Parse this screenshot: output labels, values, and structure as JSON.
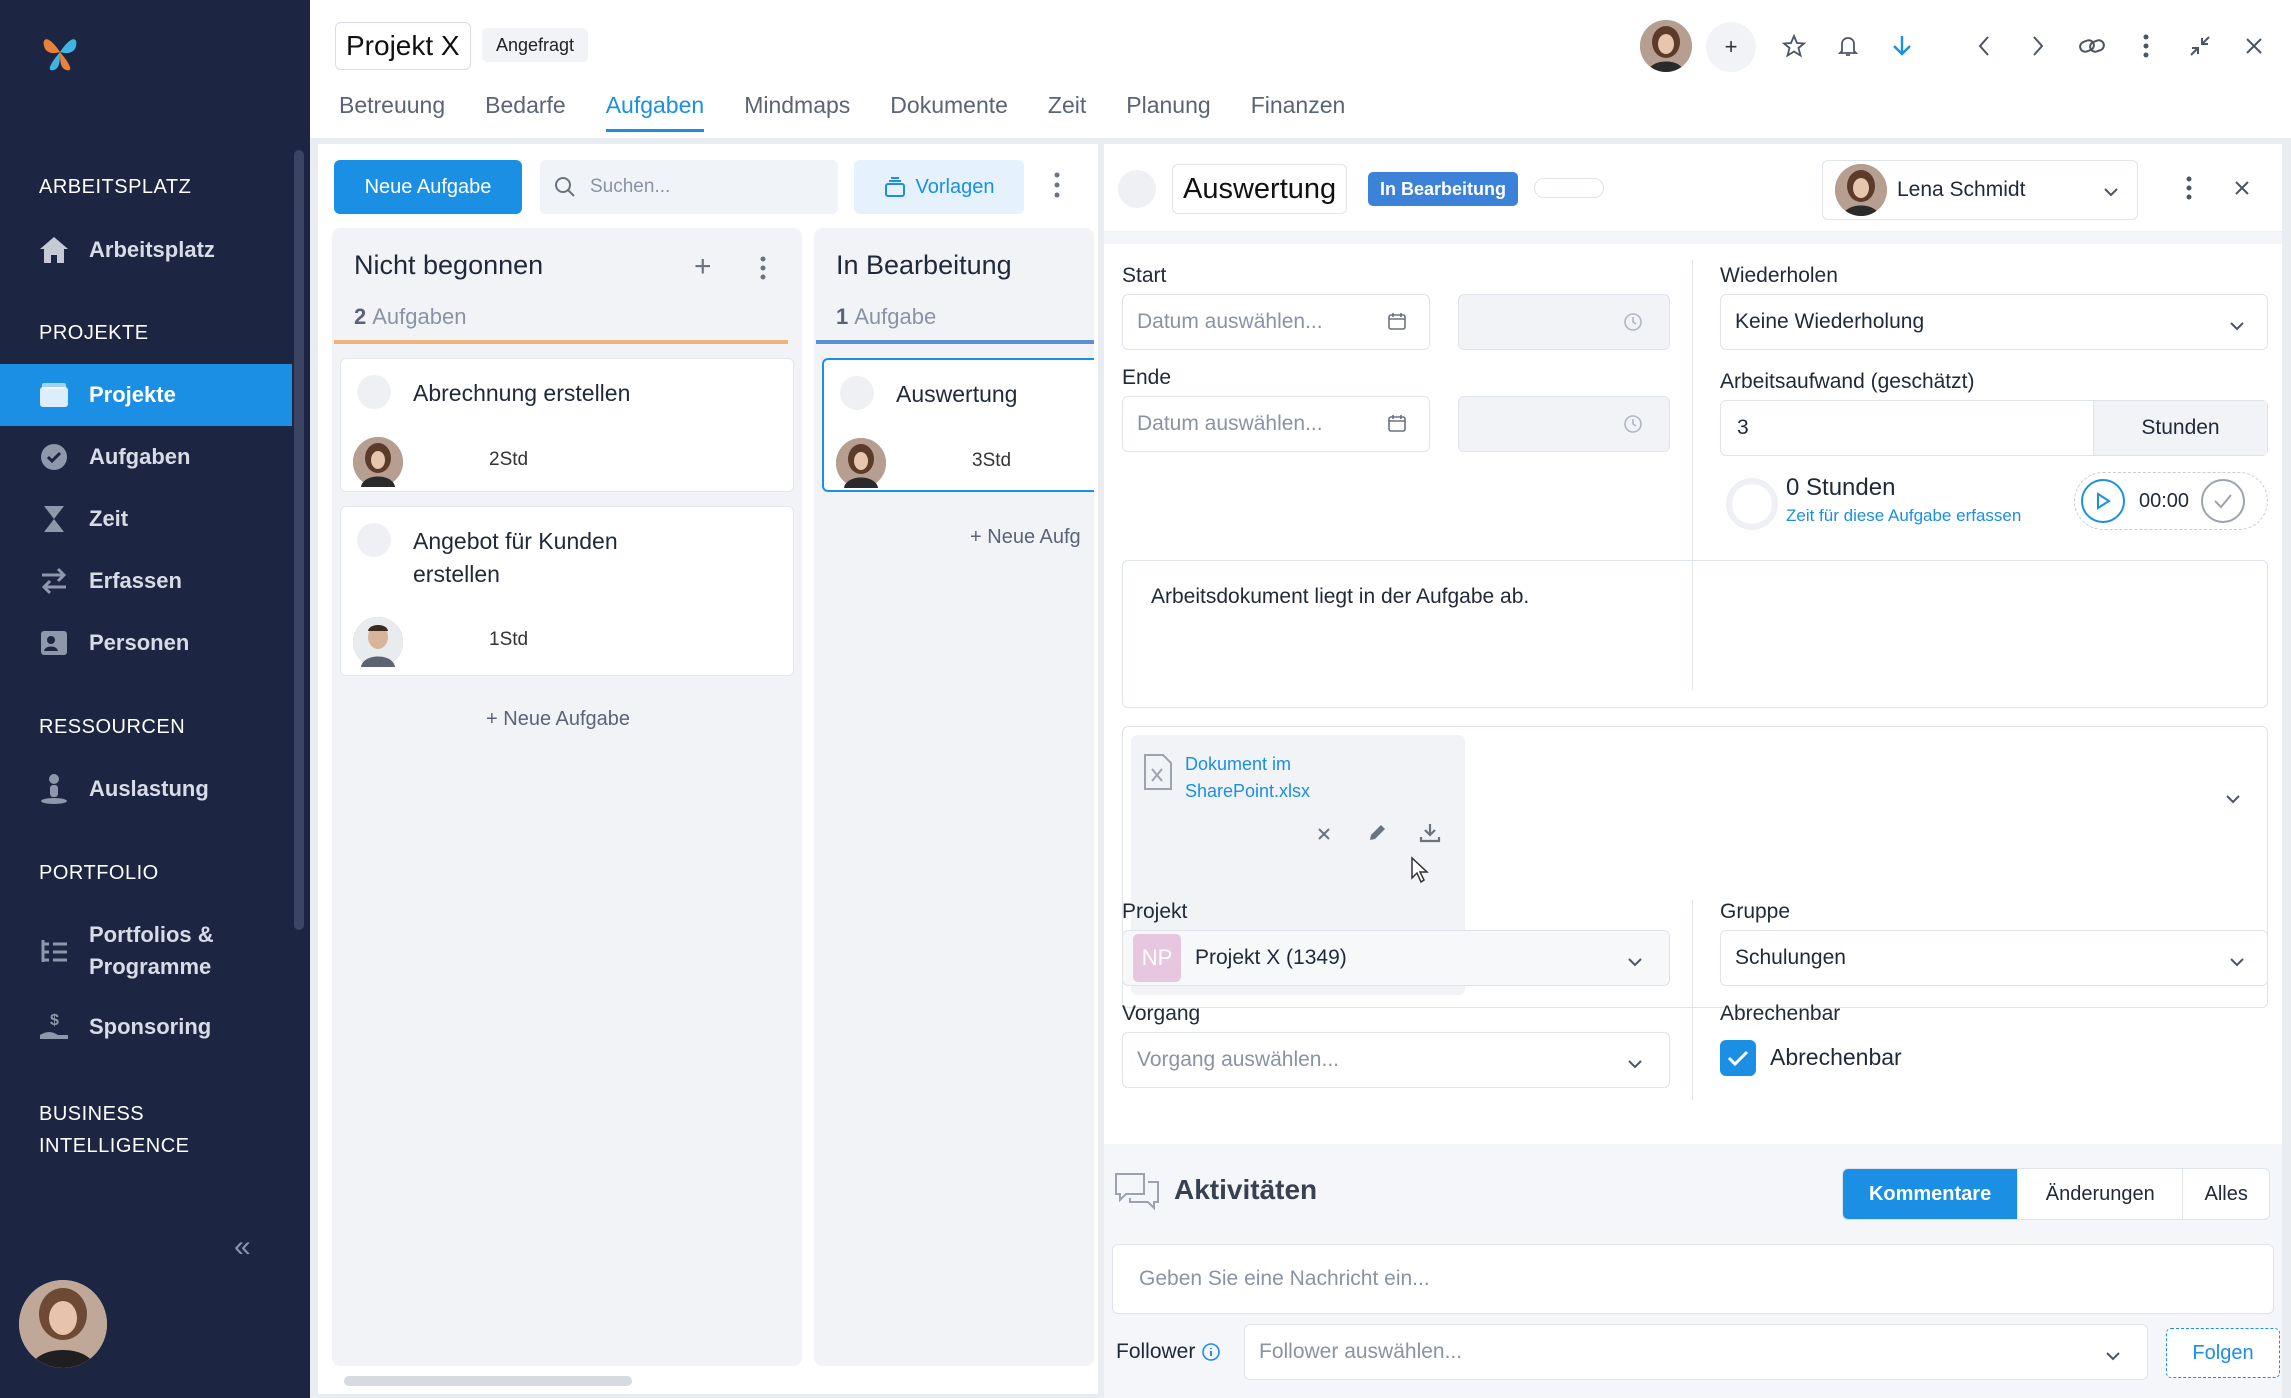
{
  "sidebar": {
    "sections": [
      {
        "heading": "ARBEITSPLATZ",
        "items": [
          {
            "label": "Arbeitsplatz",
            "icon": "home-icon"
          }
        ]
      },
      {
        "heading": "PROJEKTE",
        "items": [
          {
            "label": "Projekte",
            "icon": "folder-icon",
            "active": true
          },
          {
            "label": "Aufgaben",
            "icon": "check-circle-icon"
          },
          {
            "label": "Zeit",
            "icon": "hourglass-icon"
          },
          {
            "label": "Erfassen",
            "icon": "transfer-icon"
          },
          {
            "label": "Personen",
            "icon": "person-card-icon"
          }
        ]
      },
      {
        "heading": "RESSOURCEN",
        "items": [
          {
            "label": "Auslastung",
            "icon": "person-load-icon"
          }
        ]
      },
      {
        "heading": "PORTFOLIO",
        "items": [
          {
            "label": "Portfolios & Programme",
            "icon": "tree-list-icon"
          },
          {
            "label": "Sponsoring",
            "icon": "hand-dollar-icon"
          }
        ]
      },
      {
        "heading": "BUSINESS INTELLIGENCE",
        "items": []
      }
    ]
  },
  "header": {
    "project_name": "Projekt X",
    "status": "Angefragt",
    "add_label": "+",
    "tabs": [
      "Betreuung",
      "Bedarfe",
      "Aufgaben",
      "Mindmaps",
      "Dokumente",
      "Zeit",
      "Planung",
      "Finanzen"
    ],
    "active_tab": "Aufgaben"
  },
  "board": {
    "new_task_button": "Neue Aufgabe",
    "search_placeholder": "Suchen...",
    "templates_button": "Vorlagen",
    "columns": [
      {
        "title": "Nicht begonnen",
        "count": "2",
        "count_label": "Aufgaben",
        "accent": "#f0b27a",
        "cards": [
          {
            "title": "Abrechnung erstellen",
            "hours": "2Std"
          },
          {
            "title": "Angebot für Kunden erstellen",
            "hours": "1Std"
          }
        ],
        "add_label": "Neue Aufgabe"
      },
      {
        "title": "In Bearbeitung",
        "count": "1",
        "count_label": "Aufgabe",
        "accent": "#5b8fd6",
        "cards": [
          {
            "title": "Auswertung",
            "hours": "3Std"
          }
        ],
        "add_label": "Neue Aufg"
      }
    ]
  },
  "detail": {
    "title": "Auswertung",
    "status": "In Bearbeitung",
    "assignee": "Lena Schmidt",
    "start_label": "Start",
    "end_label": "Ende",
    "date_placeholder": "Datum auswählen...",
    "repeat_label": "Wiederholen",
    "repeat_value": "Keine Wiederholung",
    "effort_label": "Arbeitsaufwand (geschätzt)",
    "effort_value": "3",
    "effort_unit": "Stunden",
    "tracked_hours": "0 Stunden",
    "track_link": "Zeit für diese Aufgabe erfassen",
    "timer": "00:00",
    "description": "Arbeitsdokument liegt in der Aufgabe ab.",
    "attachment_line1": "Dokument im",
    "attachment_line2": "SharePoint.xlsx",
    "project_label": "Projekt",
    "project_initials": "NP",
    "project_value": "Projekt X (1349)",
    "group_label": "Gruppe",
    "group_value": "Schulungen",
    "process_label": "Vorgang",
    "process_placeholder": "Vorgang auswählen...",
    "billable_label": "Abrechenbar",
    "billable_checkbox_label": "Abrechenbar",
    "billable": true
  },
  "activities": {
    "title": "Aktivitäten",
    "tabs": [
      "Kommentare",
      "Änderungen",
      "Alles"
    ],
    "active_tab": "Kommentare",
    "message_placeholder": "Geben Sie eine Nachricht ein...",
    "follower_label": "Follower",
    "follower_placeholder": "Follower auswählen...",
    "follow_button": "Folgen"
  },
  "colors": {
    "accent": "#1a8fe3",
    "sidebar": "#1c2541"
  }
}
